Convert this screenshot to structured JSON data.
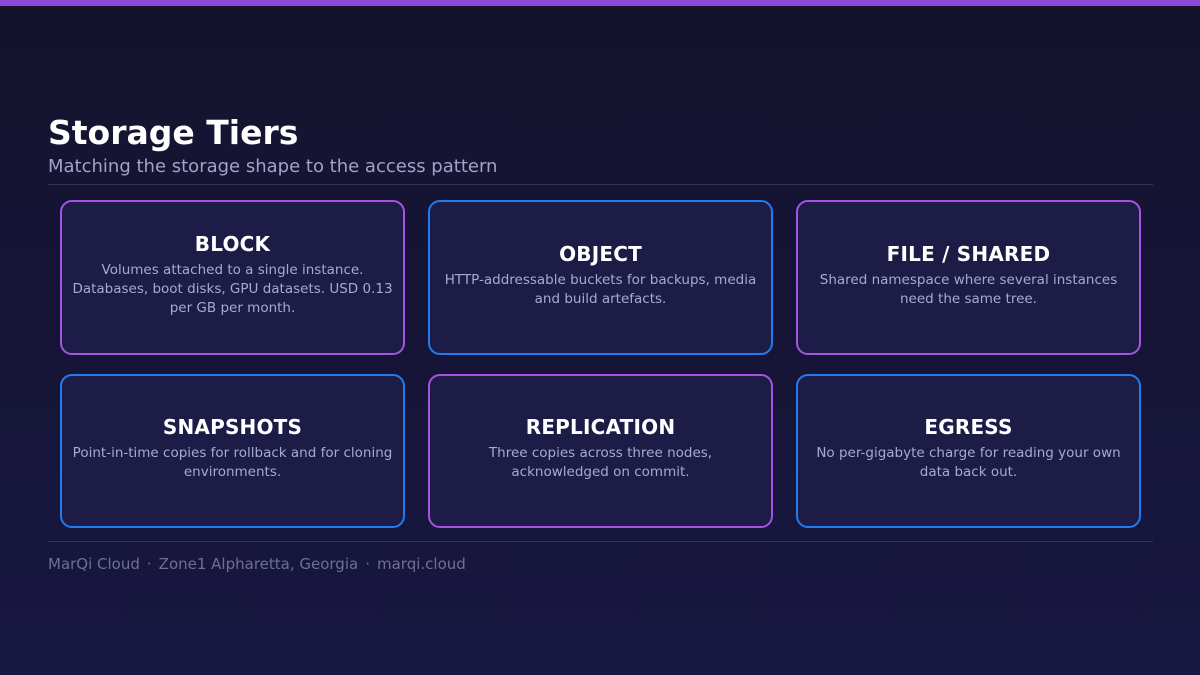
{
  "header": {
    "title": "Storage Tiers",
    "subtitle": "Matching the storage shape to the access pattern"
  },
  "colors": {
    "accent_bar": "#8b49d6",
    "border_purple": "#a652e4",
    "border_blue": "#1e7df0",
    "background": "#14132e",
    "card_fill": "#1d1c47"
  },
  "cards": [
    {
      "title": "BLOCK",
      "body": "Volumes attached to a single instance. Databases, boot disks, GPU datasets. USD 0.13 per GB per month.",
      "border": "purple"
    },
    {
      "title": "OBJECT",
      "body": "HTTP-addressable buckets for backups, media and build artefacts.",
      "border": "blue"
    },
    {
      "title": "FILE / SHARED",
      "body": "Shared namespace where several instances need the same tree.",
      "border": "purple"
    },
    {
      "title": "SNAPSHOTS",
      "body": "Point-in-time copies for rollback and for cloning environments.",
      "border": "blue"
    },
    {
      "title": "REPLICATION",
      "body": "Three copies across three nodes, acknowledged on commit.",
      "border": "purple"
    },
    {
      "title": "EGRESS",
      "body": "No per-gigabyte charge for reading your own data back out.",
      "border": "blue"
    }
  ],
  "footer": {
    "brand": "MarQi Cloud",
    "separator": "·",
    "location": "Zone1 Alpharetta, Georgia",
    "site": "marqi.cloud"
  }
}
